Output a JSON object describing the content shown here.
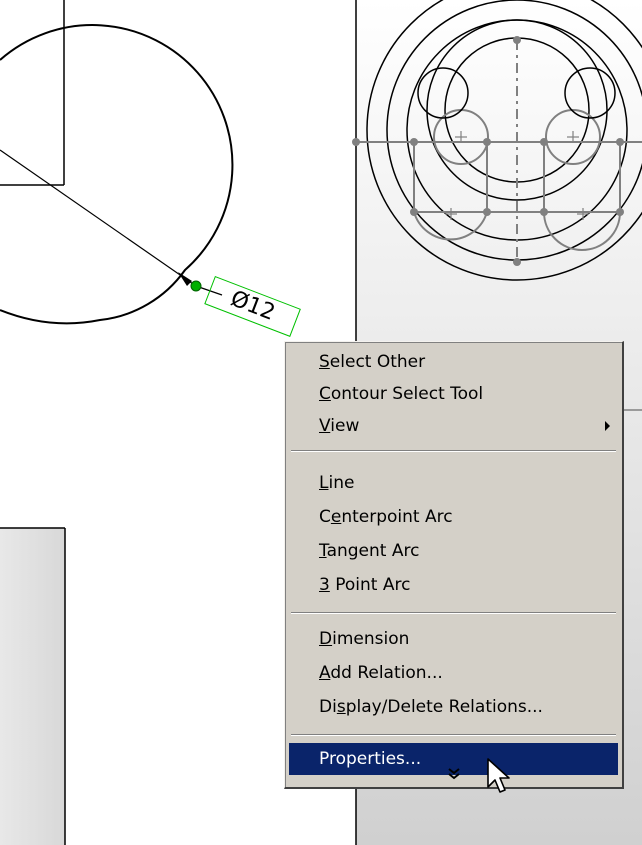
{
  "dimension": {
    "label": "Ø12"
  },
  "context_menu": {
    "items": [
      {
        "label": "Select Other",
        "mnemonic": "S"
      },
      {
        "label": "Contour Select Tool",
        "mnemonic": "C"
      },
      {
        "label": "View",
        "mnemonic": "V",
        "submenu": true
      },
      {
        "label": "Line",
        "mnemonic": "L"
      },
      {
        "label": "Centerpoint Arc",
        "mnemonic": "e"
      },
      {
        "label": "Tangent Arc",
        "mnemonic": "T"
      },
      {
        "label": "3 Point Arc",
        "mnemonic": "3"
      },
      {
        "label": "Dimension",
        "mnemonic": "D"
      },
      {
        "label": "Add Relation...",
        "mnemonic": "A"
      },
      {
        "label": "Display/Delete Relations...",
        "mnemonic": "s"
      },
      {
        "label": "Properties...",
        "highlighted": true
      }
    ],
    "expand_icon": "double-chevron-down-icon"
  },
  "colors": {
    "menu_bg": "#d4d0c8",
    "highlight": "#0a246a",
    "dimension_box": "#00c000",
    "sketch_gray": "#808080"
  }
}
